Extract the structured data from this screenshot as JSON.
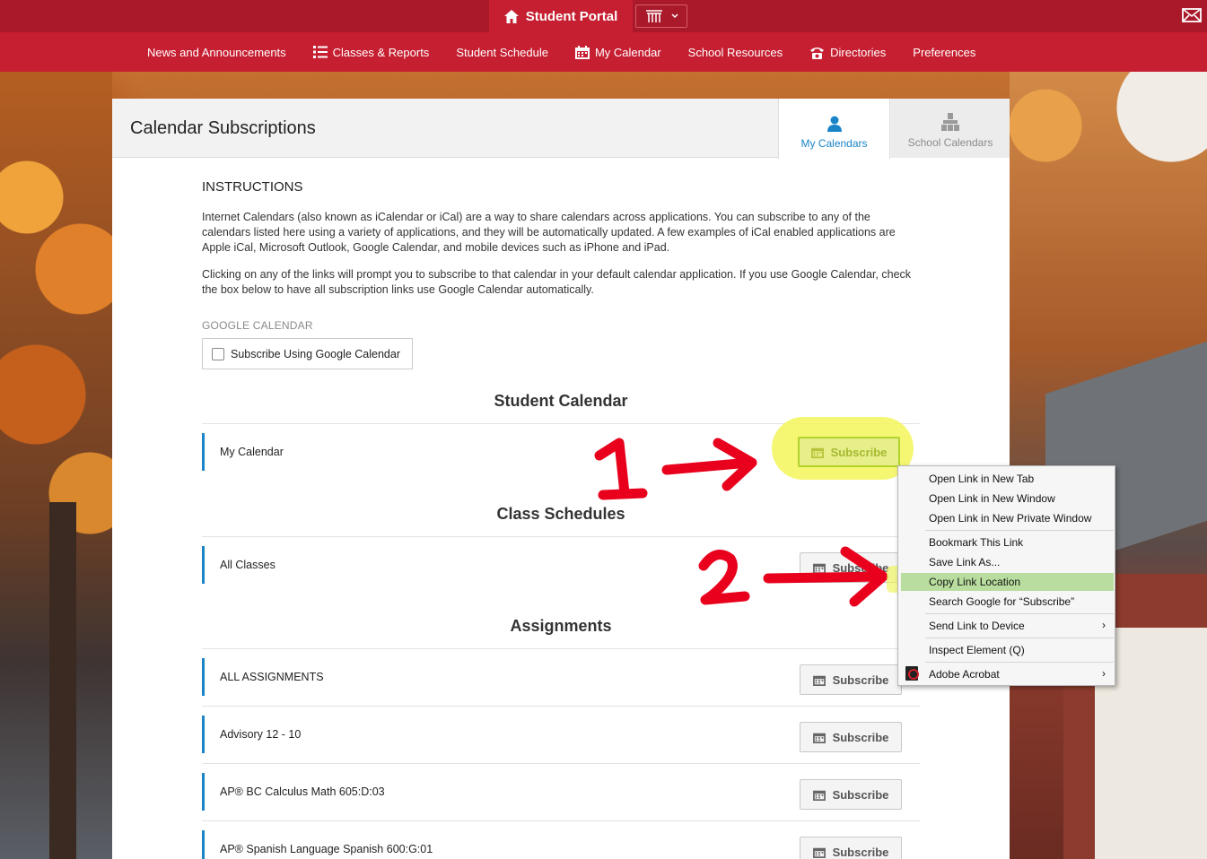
{
  "app": {
    "title": "Student Portal"
  },
  "nav": {
    "items": [
      {
        "label": "News and Announcements"
      },
      {
        "label": "Classes & Reports"
      },
      {
        "label": "Student Schedule"
      },
      {
        "label": "My Calendar"
      },
      {
        "label": "School Resources"
      },
      {
        "label": "Directories"
      },
      {
        "label": "Preferences"
      }
    ]
  },
  "panel": {
    "title": "Calendar Subscriptions",
    "tabs": [
      {
        "label": "My Calendars",
        "active": true
      },
      {
        "label": "School Calendars",
        "active": false
      }
    ]
  },
  "instructions": {
    "heading": "INSTRUCTIONS",
    "p1": "Internet Calendars (also known as iCalendar or iCal) are a way to share calendars across applications. You can subscribe to any of the calendars listed here using a variety of applications, and they will be automatically updated. A few examples of iCal enabled applications are Apple iCal, Microsoft Outlook, Google Calendar, and mobile devices such as iPhone and iPad.",
    "p2": "Clicking on any of the links will prompt you to subscribe to that calendar in your default calendar application. If you use Google Calendar, check the box below to have all subscription links use Google Calendar automatically.",
    "google_label": "GOOGLE CALENDAR",
    "google_checkbox": "Subscribe Using Google Calendar",
    "google_checked": false
  },
  "sections": [
    {
      "title": "Student Calendar",
      "rows": [
        {
          "name": "My Calendar",
          "button": "Subscribe"
        }
      ]
    },
    {
      "title": "Class Schedules",
      "rows": [
        {
          "name": "All Classes",
          "button": "Subscribe"
        }
      ]
    },
    {
      "title": "Assignments",
      "rows": [
        {
          "name": "ALL ASSIGNMENTS",
          "button": "Subscribe"
        },
        {
          "name": "Advisory 12 - 10",
          "button": "Subscribe"
        },
        {
          "name": "AP® BC Calculus Math 605:D:03",
          "button": "Subscribe"
        },
        {
          "name": "AP® Spanish Language Spanish 600:G:01",
          "button": "Subscribe"
        }
      ]
    }
  ],
  "context_menu": {
    "items": [
      "Open Link in New Tab",
      "Open Link in New Window",
      "Open Link in New Private Window",
      "Bookmark This Link",
      "Save Link As...",
      "Copy Link Location",
      "Search Google for “Subscribe”",
      "Send Link to Device",
      "Inspect Element (Q)",
      "Adobe Acrobat"
    ],
    "highlighted": "Copy Link Location"
  },
  "annotations": {
    "step1": "1",
    "step2": "2",
    "color": "#e8001c",
    "highlight_color": "#f3f65a"
  }
}
